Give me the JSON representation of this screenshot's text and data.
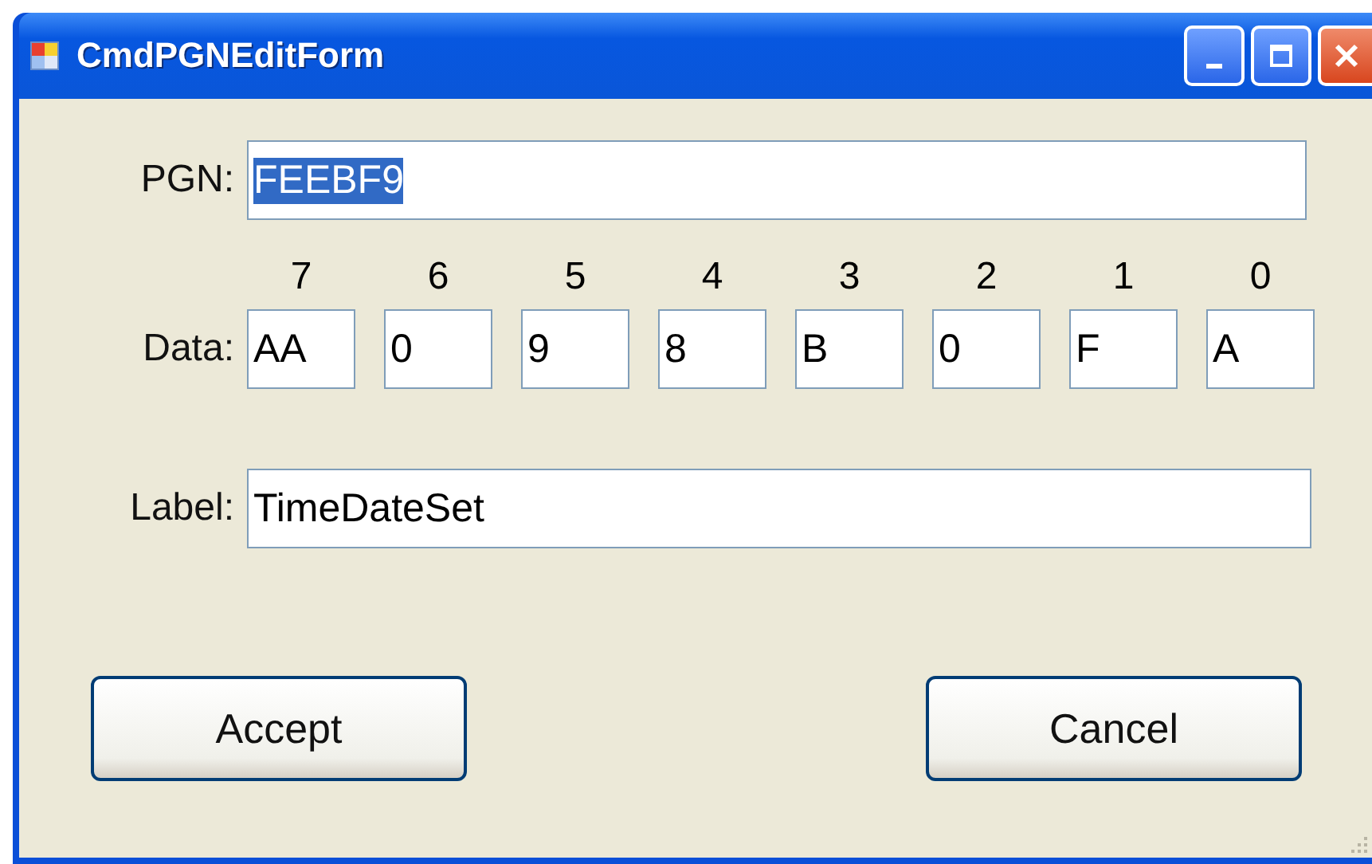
{
  "window": {
    "title": "CmdPGNEditForm"
  },
  "pgn": {
    "label": "PGN:",
    "value": "FEEBF9",
    "selected": true
  },
  "data": {
    "label": "Data:",
    "bytes": [
      {
        "index": "7",
        "value": "AA"
      },
      {
        "index": "6",
        "value": "0"
      },
      {
        "index": "5",
        "value": "9"
      },
      {
        "index": "4",
        "value": "8"
      },
      {
        "index": "3",
        "value": "B"
      },
      {
        "index": "2",
        "value": "0"
      },
      {
        "index": "1",
        "value": "F"
      },
      {
        "index": "0",
        "value": "A"
      }
    ]
  },
  "label_field": {
    "label": "Label:",
    "value": "TimeDateSet"
  },
  "buttons": [
    "Accept",
    "Cancel"
  ]
}
